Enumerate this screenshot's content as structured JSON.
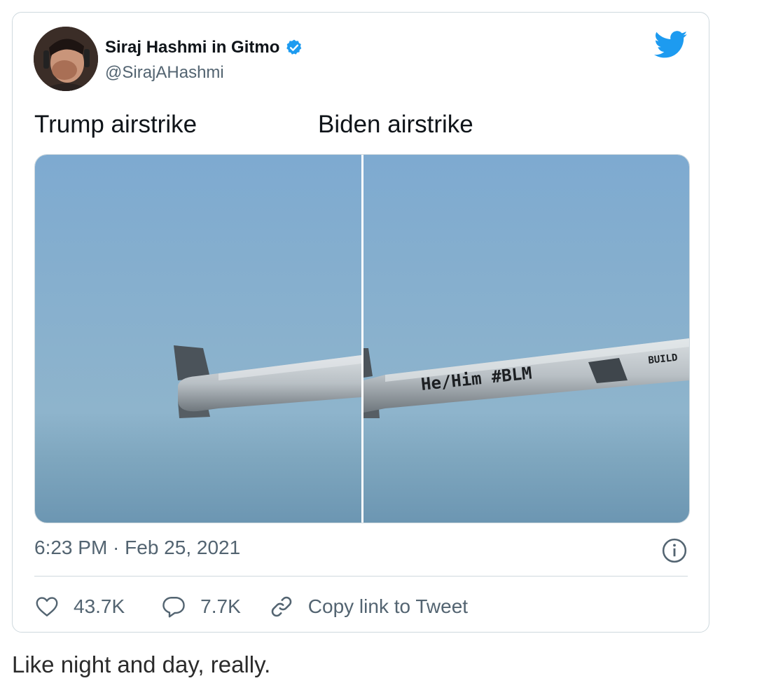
{
  "tweet": {
    "display_name": "Siraj Hashmi in Gitmo",
    "handle": "@SirajAHashmi",
    "verified": true,
    "icons": {
      "avatar": "avatar",
      "verified": "verified-badge-icon",
      "brand": "twitter-bird-icon",
      "info": "info-icon",
      "like": "heart-icon",
      "reply": "reply-bubble-icon",
      "link": "link-icon"
    },
    "captions": {
      "left": "Trump airstrike",
      "right": "Biden airstrike"
    },
    "media": {
      "left_panel_text": "",
      "right_panel_text": "He/Him #BLM",
      "right_panel_text_2": "BUILD"
    },
    "timestamp": "6:23 PM · Feb 25, 2021",
    "actions": {
      "likes": "43.7K",
      "replies": "7.7K",
      "copy_link": "Copy link to Tweet"
    }
  },
  "post_caption": "Like night and day, really.",
  "colors": {
    "brand": "#1d9bf0",
    "text": "#0f1419",
    "muted": "#536471",
    "border": "#cfd9de",
    "sky": "#7ea8c6"
  }
}
